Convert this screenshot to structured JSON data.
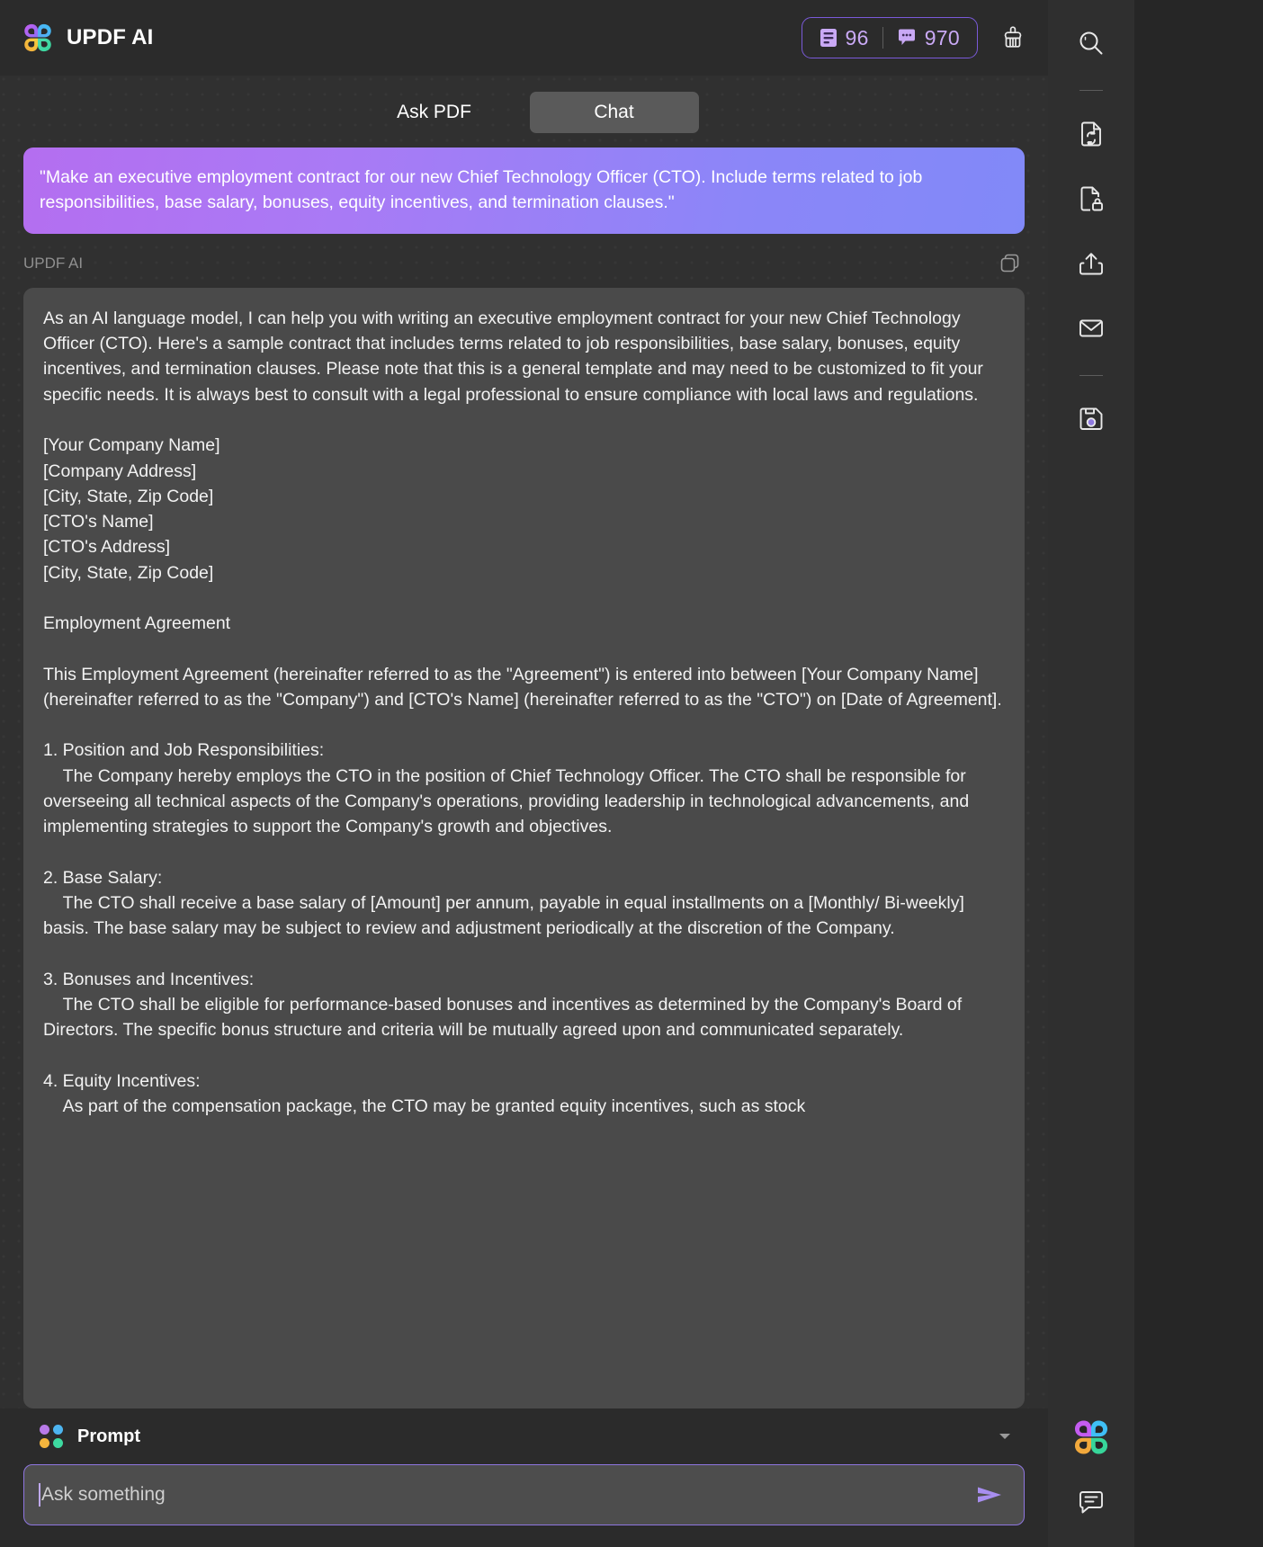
{
  "app": {
    "title": "UPDF AI",
    "logo_icon": "updf-clover-logo"
  },
  "header": {
    "counter": {
      "pages_icon": "document-pages-icon",
      "pages_count": "96",
      "separator": "|",
      "chat_icon": "chat-bubble-icon",
      "chat_count": "970",
      "border_color": "#7a5ad9",
      "text_color": "#c9a9f5"
    },
    "clear_button": {
      "icon": "brush-icon",
      "label": "Clear"
    }
  },
  "tabs": [
    {
      "id": "ask-pdf",
      "label": "Ask PDF",
      "active": false
    },
    {
      "id": "chat",
      "label": "Chat",
      "active": true
    }
  ],
  "conversation": {
    "user_message": {
      "text": "\"Make an executive employment contract for our new Chief Technology Officer (CTO). Include terms related to job responsibilities, base salary, bonuses, equity incentives, and termination clauses.\"",
      "gradient_from": "#b46ef0",
      "gradient_to": "#8189f8"
    },
    "assistant": {
      "name": "UPDF AI",
      "copy_icon": "copy-icon",
      "paragraphs": [
        "As an AI language model, I can help you with writing an executive employment contract for your new Chief Technology Officer (CTO). Here's a sample contract that includes terms related to job responsibilities, base salary, bonuses, equity incentives, and termination clauses. Please note that this is a general template and may need to be customized to fit your specific needs. It is always best to consult with a legal professional to ensure compliance with local laws and regulations.",
        "[Your Company Name]\n[Company Address]\n[City, State, Zip Code]\n[CTO's Name]\n[CTO's Address]\n[City, State, Zip Code]",
        "Employment Agreement",
        "This Employment Agreement (hereinafter referred to as the \"Agreement\") is entered into between [Your Company Name] (hereinafter referred to as the \"Company\") and [CTO's Name] (hereinafter referred to as the \"CTO\") on [Date of Agreement].",
        "1. Position and Job Responsibilities:\n    The Company hereby employs the CTO in the position of Chief Technology Officer. The CTO shall be responsible for overseeing all technical aspects of the Company's operations, providing leadership in technological advancements, and implementing strategies to support the Company's growth and objectives.",
        "2. Base Salary:\n    The CTO shall receive a base salary of [Amount] per annum, payable in equal installments on a [Monthly/ Bi-weekly] basis. The base salary may be subject to review and adjustment periodically at the discretion of the Company.",
        "3. Bonuses and Incentives:\n    The CTO shall be eligible for performance-based bonuses and incentives as determined by the Company's Board of Directors. The specific bonus structure and criteria will be mutually agreed upon and communicated separately.",
        "4. Equity Incentives:\n    As part of the compensation package, the CTO may be granted equity incentives, such as stock"
      ]
    }
  },
  "composer": {
    "prompt_label": "Prompt",
    "prompt_icon": "four-dots-icon",
    "prompt_dot_colors": [
      "#b87ae8",
      "#4db5f0",
      "#f5b53d",
      "#3dd9a0"
    ],
    "expand_icon": "chevron-down-icon",
    "input_placeholder": "Ask something",
    "input_value": "",
    "send_icon": "send-icon",
    "border_color": "#8f76e0"
  },
  "right_toolbar": {
    "items": [
      {
        "id": "search",
        "icon": "search-icon",
        "label": "Search"
      },
      {
        "id": "divider-1",
        "icon": "divider",
        "label": ""
      },
      {
        "id": "convert",
        "icon": "convert-file-icon",
        "label": "Convert PDF"
      },
      {
        "id": "protect",
        "icon": "protect-file-icon",
        "label": "Protect"
      },
      {
        "id": "share",
        "icon": "share-upload-icon",
        "label": "Share"
      },
      {
        "id": "email",
        "icon": "envelope-icon",
        "label": "Email"
      },
      {
        "id": "divider-2",
        "icon": "divider",
        "label": ""
      },
      {
        "id": "save",
        "icon": "save-disk-icon",
        "label": "Save"
      }
    ],
    "bottom_items": [
      {
        "id": "updf-ai",
        "icon": "updf-clover-logo",
        "label": "UPDF AI"
      },
      {
        "id": "comment",
        "icon": "comment-icon",
        "label": "Comment"
      }
    ]
  }
}
